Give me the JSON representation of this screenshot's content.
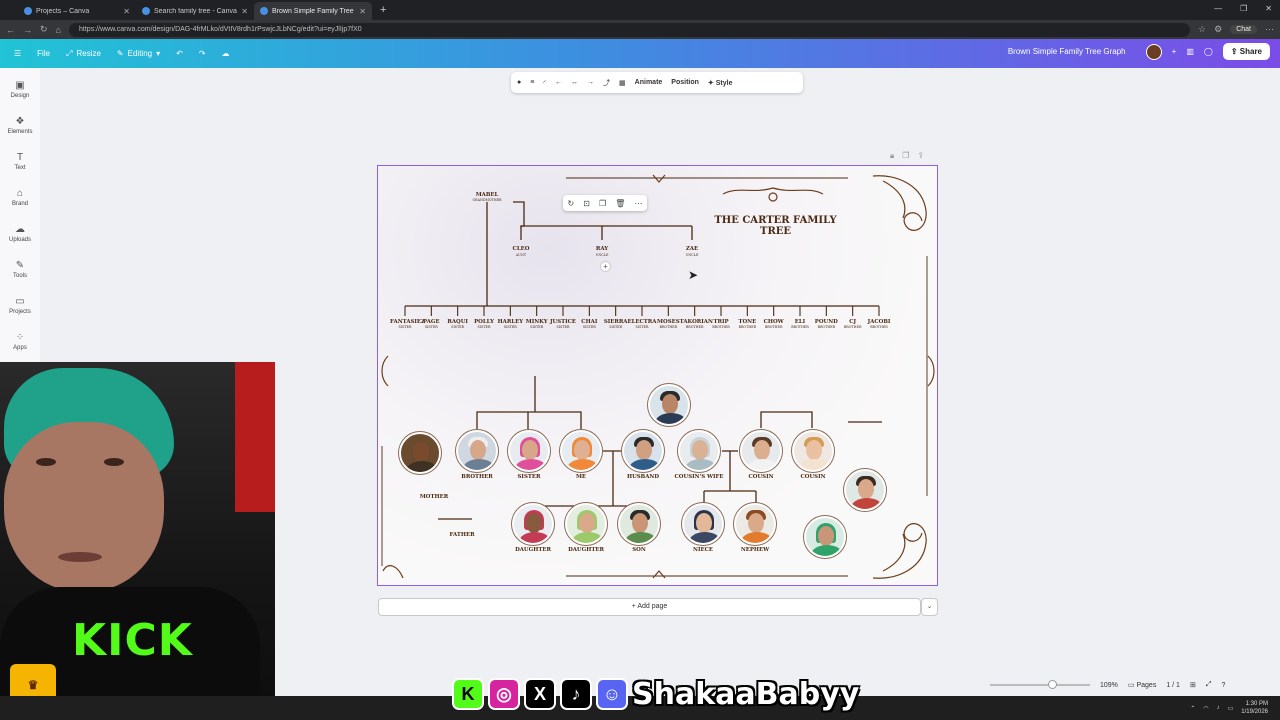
{
  "browser": {
    "tabs": [
      {
        "label": "Projects – Canva",
        "active": false
      },
      {
        "label": "Search family tree - Canva",
        "active": false
      },
      {
        "label": "Brown Simple Family Tree Graph",
        "active": true
      }
    ],
    "url": "https://www.canva.com/design/DAG-4frMLko/dVtIV8rdh1rPswjcJLbNCg/edit?ui=eyJlIjp7fX0",
    "chat_label": "Chat"
  },
  "header": {
    "file": "File",
    "resize": "Resize",
    "editing": "Editing",
    "doc_title": "Brown Simple Family Tree Graph",
    "share": "Share"
  },
  "sidebar": {
    "items": [
      {
        "label": "Design",
        "icon": "design-icon"
      },
      {
        "label": "Elements",
        "icon": "elements-icon"
      },
      {
        "label": "Text",
        "icon": "text-icon"
      },
      {
        "label": "Brand",
        "icon": "brand-icon"
      },
      {
        "label": "Uploads",
        "icon": "uploads-icon"
      },
      {
        "label": "Tools",
        "icon": "tools-icon"
      },
      {
        "label": "Projects",
        "icon": "projects-icon"
      },
      {
        "label": "Apps",
        "icon": "apps-icon"
      }
    ]
  },
  "context_toolbar": {
    "animate": "Animate",
    "position": "Position",
    "style": "Style"
  },
  "tree": {
    "title": "THE CARTER FAMILY TREE",
    "grandmother": {
      "name": "MABEL",
      "role": "GRANDMOTHER"
    },
    "aunts_uncles": [
      {
        "name": "CLEO",
        "role": "AUNT"
      },
      {
        "name": "RAY",
        "role": "UNCLE"
      },
      {
        "name": "ZAE",
        "role": "UNCLE"
      }
    ],
    "siblings": [
      {
        "name": "FANTASIEZ",
        "role": "SISTER"
      },
      {
        "name": "PAGE",
        "role": "SISTER"
      },
      {
        "name": "RAQUI",
        "role": "SISTER"
      },
      {
        "name": "POLLY",
        "role": "SISTER"
      },
      {
        "name": "HARLEY",
        "role": "SISTER"
      },
      {
        "name": "MINKY",
        "role": "SISTER"
      },
      {
        "name": "JUSTICE",
        "role": "SISTER"
      },
      {
        "name": "CHAI",
        "role": "SISTER"
      },
      {
        "name": "SIERRA",
        "role": "SISTER"
      },
      {
        "name": "ELECTRA",
        "role": "SISTER"
      },
      {
        "name": "MOSES",
        "role": "BROTHER"
      },
      {
        "name": "TAKORIAN",
        "role": "BROTHER"
      },
      {
        "name": "TRIP",
        "role": "BROTHER"
      },
      {
        "name": "TONE",
        "role": "BROTHER"
      },
      {
        "name": "CHOW",
        "role": "BROTHER"
      },
      {
        "name": "ELI",
        "role": "BROTHER"
      },
      {
        "name": "POUND",
        "role": "BROTHER"
      },
      {
        "name": "CJ",
        "role": "BROTHER"
      },
      {
        "name": "JACOBI",
        "role": "BROTHER"
      }
    ],
    "labels": {
      "mother": "MOTHER",
      "father": "FATHER",
      "brother": "BROTHER",
      "sister": "SISTER",
      "me": "ME",
      "husband": "HUSBAND",
      "cousins_wife": "COUSIN'S WIFE",
      "cousin1": "COUSIN",
      "cousin2": "COUSIN",
      "daughter1": "DAUGHTER",
      "daughter2": "DAUGHTER",
      "son": "SON",
      "niece": "NIECE",
      "nephew": "NEPHEW"
    },
    "colors": {
      "ink": "#4a2a12",
      "selection": "#8e5fe4"
    }
  },
  "add_page": "+ Add page",
  "bottom": {
    "zoom": "109%",
    "pages_label": "Pages",
    "page_count": "1 / 1"
  },
  "overlay": {
    "kick": "KICK",
    "handle": "ShakaaBabyy"
  },
  "taskbar": {
    "time": "1:30 PM",
    "date": "1/19/2026"
  }
}
